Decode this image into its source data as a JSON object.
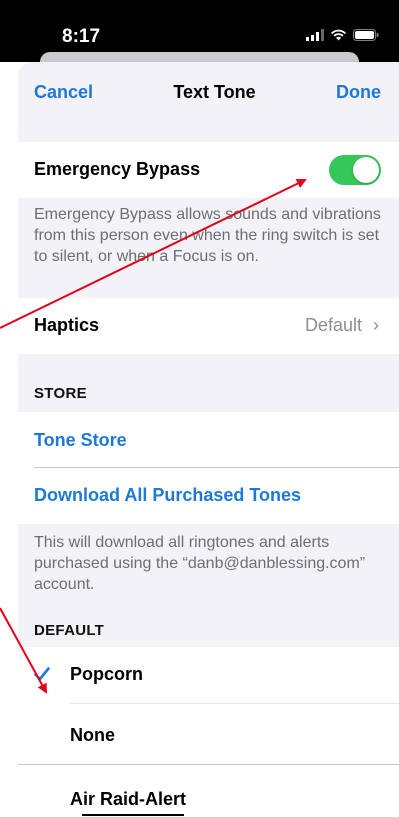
{
  "status": {
    "time": "8:17"
  },
  "nav": {
    "cancel": "Cancel",
    "title": "Text Tone",
    "done": "Done"
  },
  "emergency": {
    "label": "Emergency Bypass",
    "enabled": true,
    "footer": "Emergency Bypass allows sounds and vibrations from this person even when the ring switch is set to silent, or when a Focus is on."
  },
  "haptics": {
    "label": "Haptics",
    "value": "Default",
    "chevron": "›"
  },
  "store": {
    "header": "STORE",
    "tone_store": "Tone Store",
    "download_all": "Download All Purchased Tones",
    "footer": "This will download all ringtones and alerts purchased using the “danb@danblessing.com” account."
  },
  "default": {
    "header": "DEFAULT",
    "items": [
      {
        "label": "Popcorn",
        "checked": true
      },
      {
        "label": "None",
        "checked": false
      },
      {
        "label": "Air Raid-Alert",
        "checked": false
      }
    ]
  },
  "colors": {
    "accent": "#1e78d8",
    "toggle_on": "#34c759",
    "annotation": "#e0001b"
  }
}
